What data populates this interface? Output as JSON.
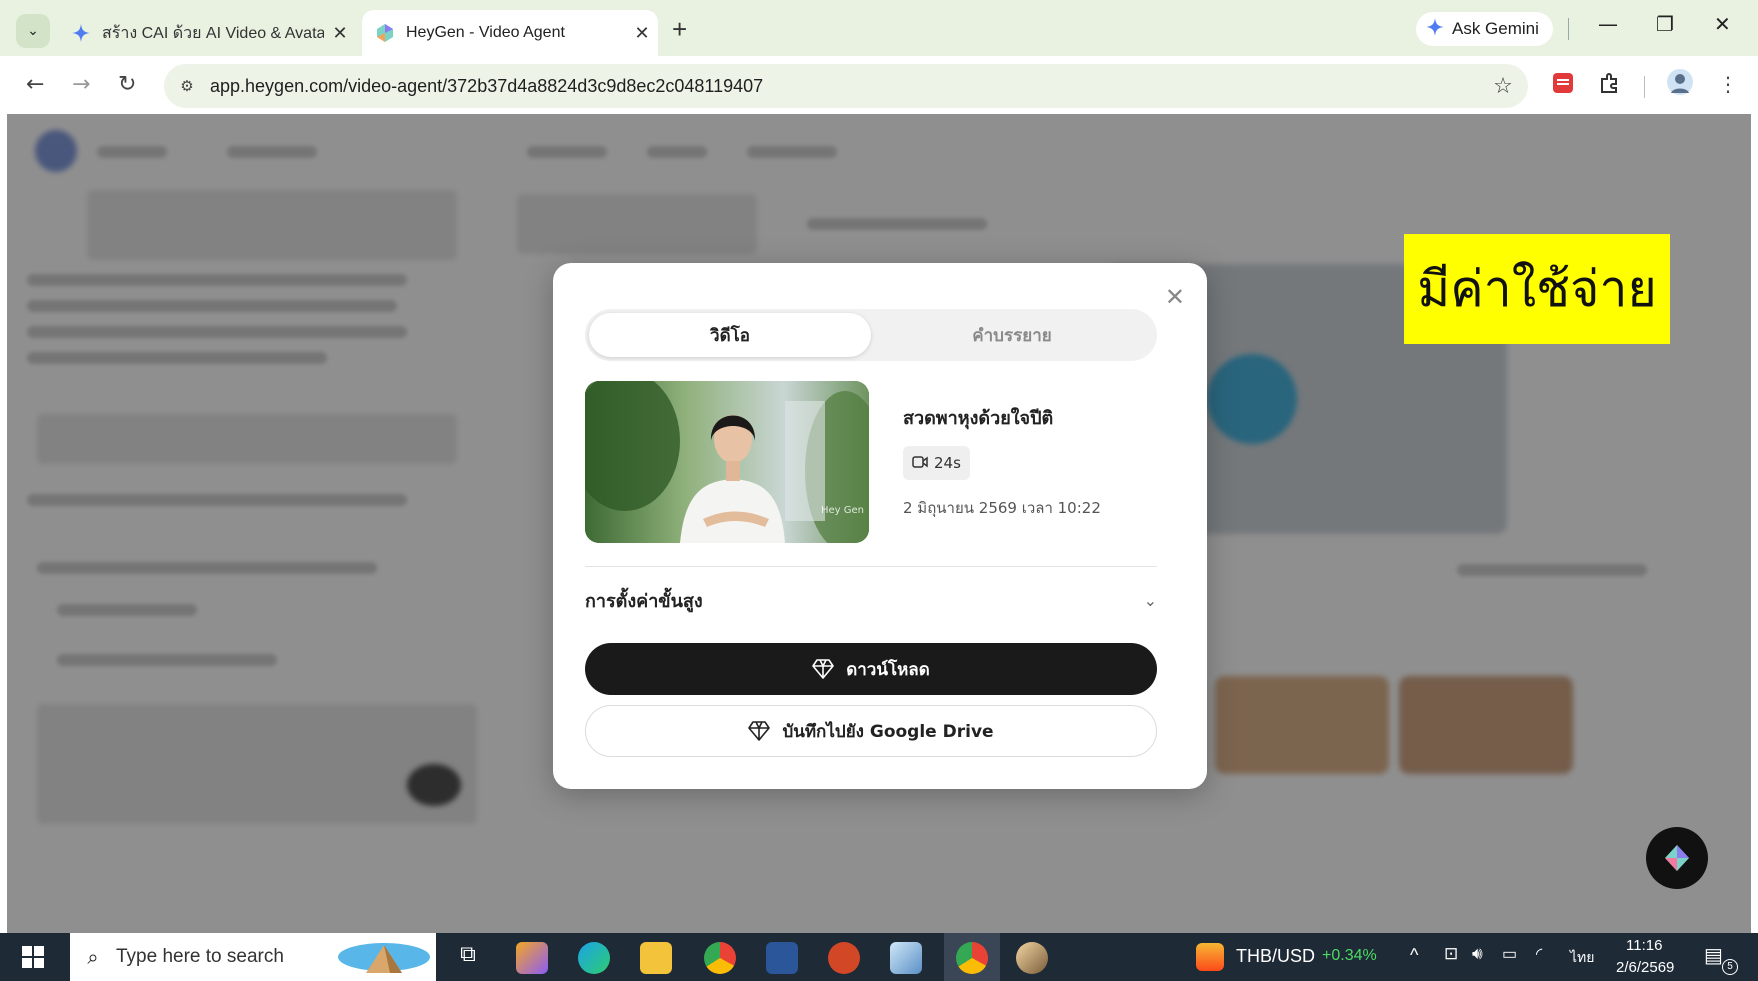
{
  "browser": {
    "tabs": [
      {
        "title": "สร้าง CAI ด้วย AI Video & Avatar",
        "active": false
      },
      {
        "title": "HeyGen - Video Agent",
        "active": true
      }
    ],
    "ask_gemini": "Ask Gemini",
    "url": "app.heygen.com/video-agent/372b37d4a8824d3c9d8ec2c048119407"
  },
  "overlay_label": "มีค่าใช้จ่าย",
  "modal": {
    "tabs": [
      "วิดีโอ",
      "คำบรรยาย"
    ],
    "active_tab": 0,
    "video": {
      "title": "สวดพาหุงด้วยใจปีติ",
      "duration": "24s",
      "date": "2 มิถุนายน 2569 เวลา 10:22",
      "watermark": "Hey Gen"
    },
    "advanced_settings": "การตั้งค่าขั้นสูง",
    "download_label": "ดาวน์โหลด",
    "drive_label": "บันทึกไปยัง Google Drive"
  },
  "taskbar": {
    "search_placeholder": "Type here to search",
    "currency_pair": "THB/USD",
    "currency_change": "+0.34%",
    "language": "ไทย",
    "time": "11:16",
    "date": "2/6/2569",
    "notification_count": "5"
  },
  "colors": {
    "tabbar_bg": "#e9f1e1",
    "overlay_yellow": "#ffff00",
    "download_bg": "#1a1a1a",
    "taskbar_bg": "#1f2a37",
    "currency_up": "#4cd964"
  }
}
